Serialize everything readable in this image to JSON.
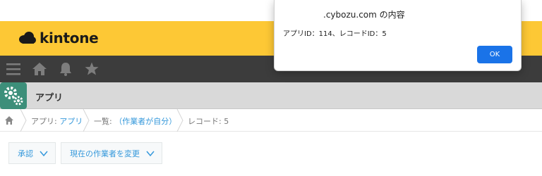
{
  "header": {
    "brand": "kintone"
  },
  "nav": {
    "icons": [
      "menu-icon",
      "home-icon",
      "bell-icon",
      "star-icon"
    ]
  },
  "app": {
    "title": "アプリ"
  },
  "breadcrumb": {
    "app_prefix": "アプリ: ",
    "app_link": "アプリ",
    "list_prefix": "一覧: ",
    "list_link": "（作業者が自分）",
    "record": "レコード: 5"
  },
  "toolbar": {
    "action_label": "承認",
    "assignee_label": "現在の作業者を変更"
  },
  "dialog": {
    "title": ".cybozu.com の内容",
    "message": "アプリID：114、レコードID：5",
    "ok_label": "OK"
  },
  "colors": {
    "brand_yellow": "#fdc835",
    "nav_dark": "#3c3c3c",
    "link_blue": "#3498db",
    "ok_blue": "#1a73e8",
    "app_icon_green": "#3d8f7a"
  }
}
